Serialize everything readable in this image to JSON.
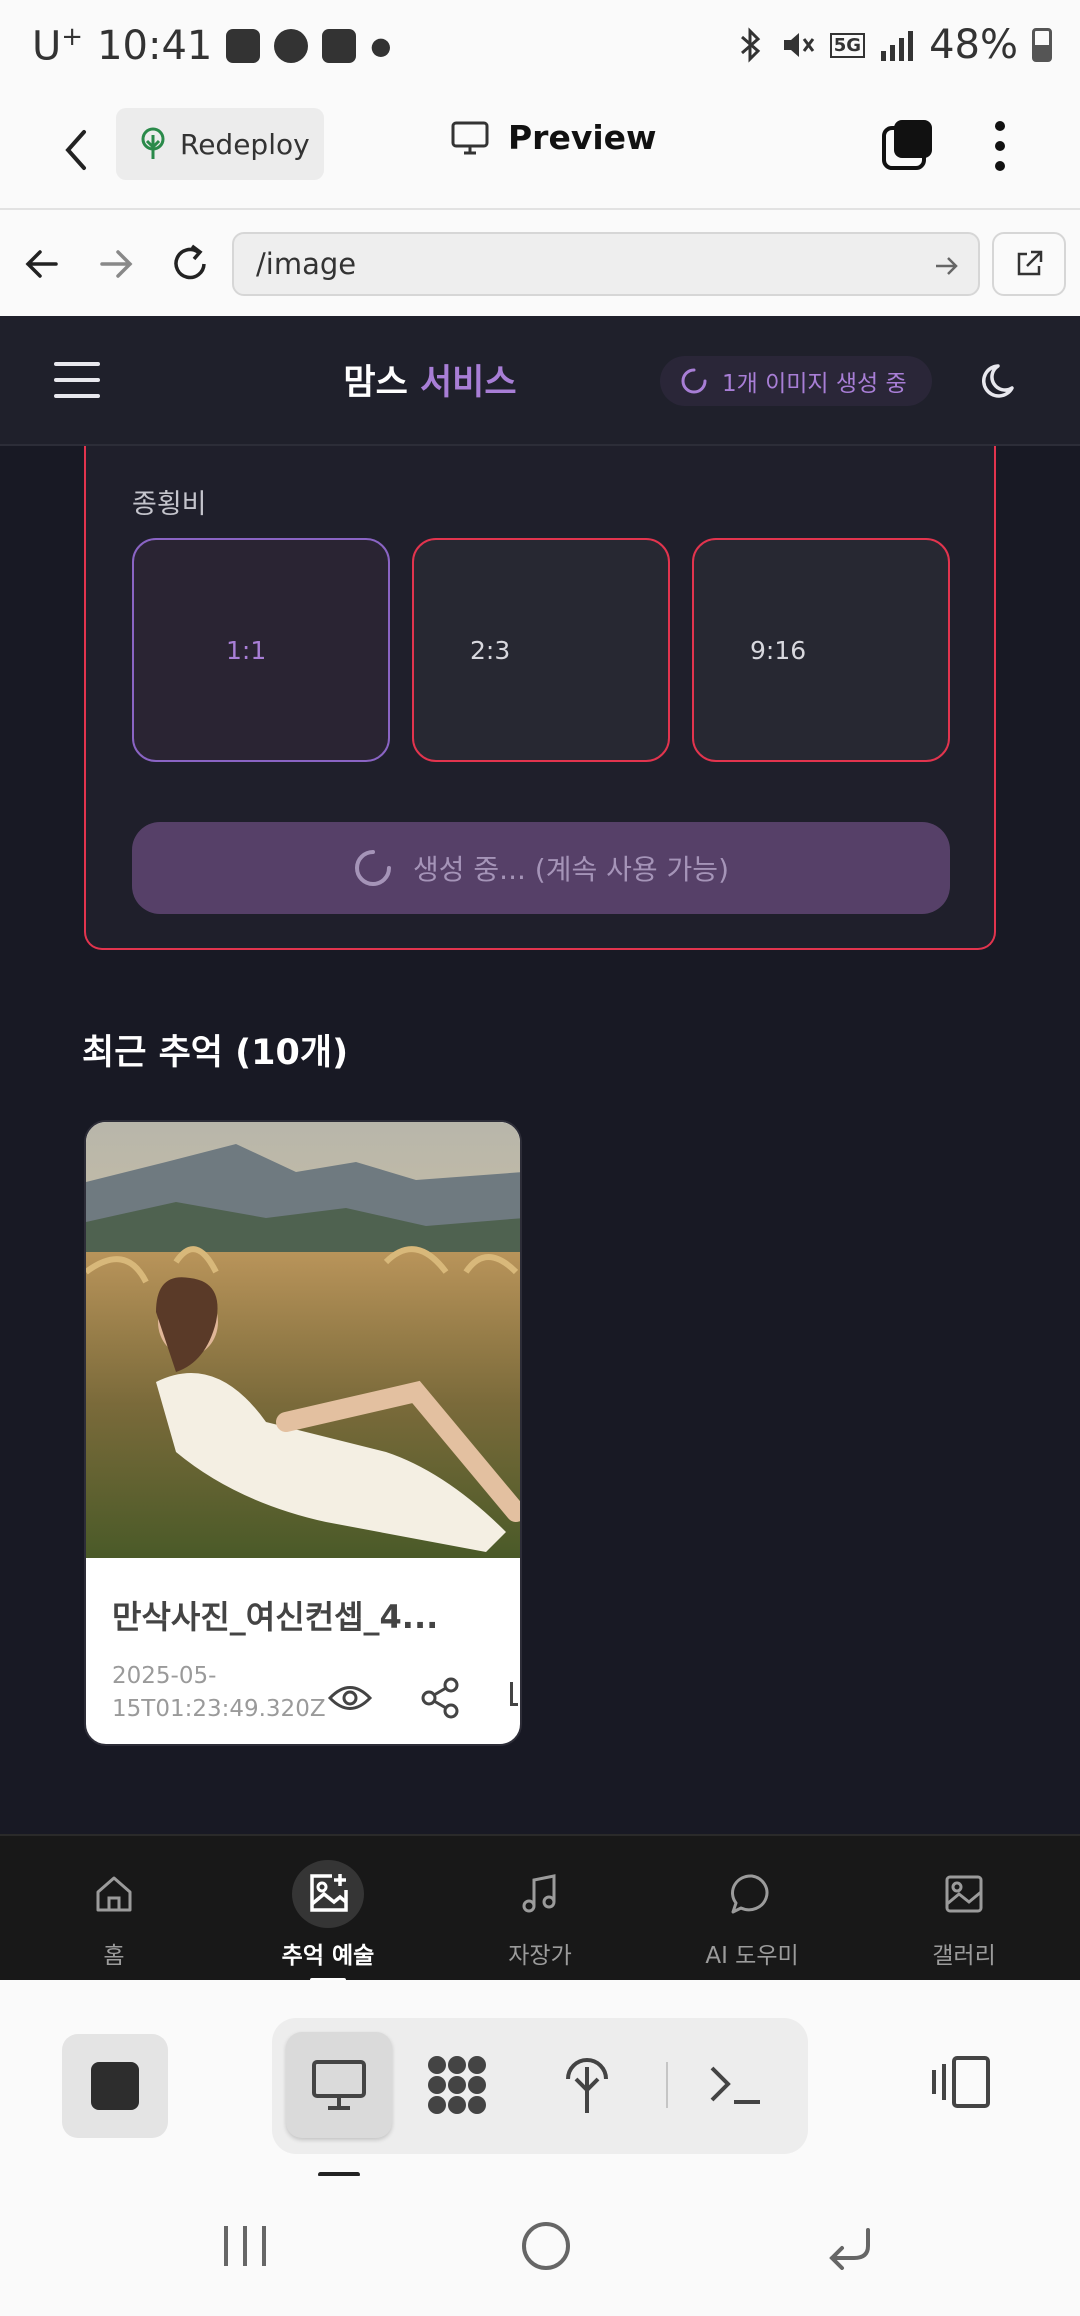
{
  "status_bar": {
    "carrier": "U",
    "carrier_sup": "+",
    "time": "10:41",
    "battery": "48%"
  },
  "app_header": {
    "redeploy_label": "Redeploy",
    "preview_label": "Preview"
  },
  "browser": {
    "url": "/image"
  },
  "site": {
    "title_part1": "맘스",
    "title_part2": "서비스",
    "generating_badge": "1개 이미지 생성 중",
    "accent_color": "#a87ed6"
  },
  "settings_panel": {
    "aspect_label": "종횡비",
    "ratios": [
      {
        "label": "1:1",
        "selected": true
      },
      {
        "label": "2:3",
        "selected": false
      },
      {
        "label": "9:16",
        "selected": false
      }
    ],
    "generate_button": "생성 중... (계속 사용 가능)"
  },
  "recent": {
    "heading": "최근 추억 (10개)",
    "cards": [
      {
        "title": "만삭사진_여신컨셉_4...",
        "date_line1": "2025-05-",
        "date_line2": "15T01:23:49.320Z",
        "icons": [
          "eye-icon",
          "share-icon"
        ]
      }
    ]
  },
  "bottom_nav": {
    "items": [
      {
        "label": "홈",
        "icon": "home-icon",
        "active": false
      },
      {
        "label": "추억 예술",
        "icon": "image-plus-icon",
        "active": true
      },
      {
        "label": "자장가",
        "icon": "music-note-icon",
        "active": false
      },
      {
        "label": "AI 도우미",
        "icon": "chat-bubble-icon",
        "active": false
      },
      {
        "label": "갤러리",
        "icon": "gallery-icon",
        "active": false
      }
    ]
  },
  "ide_toolbar": {
    "tools": [
      "monitor-icon",
      "grid-blob-icon",
      "deploy-tree-icon",
      "terminal-icon"
    ],
    "active_tool": "monitor-icon"
  }
}
